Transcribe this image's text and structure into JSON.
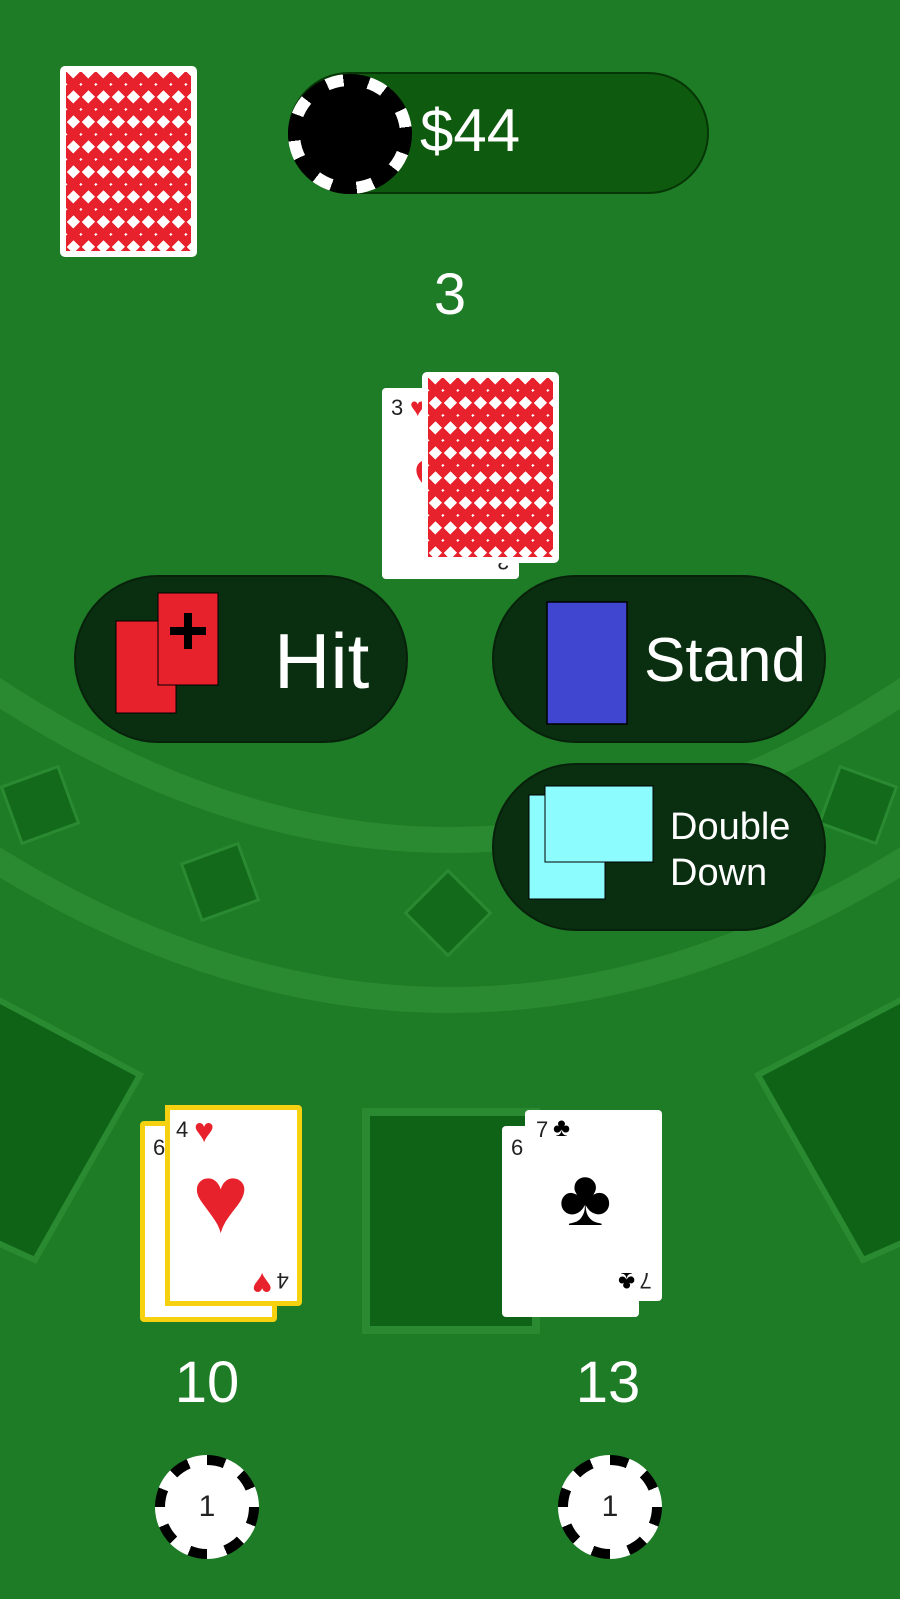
{
  "bank": {
    "amount": "$44"
  },
  "dealer": {
    "count": "3",
    "card": {
      "rank": "3",
      "suit": "♥"
    }
  },
  "actions": {
    "hit": "Hit",
    "stand": "Stand",
    "double_line1": "Double",
    "double_line2": "Down"
  },
  "hands": [
    {
      "count": "10",
      "bet": "1",
      "cards": [
        {
          "rank": "6",
          "suit": "♥",
          "color": "#e8222c"
        },
        {
          "rank": "4",
          "suit": "♥",
          "color": "#e8222c"
        }
      ]
    },
    {
      "count": "13",
      "bet": "1",
      "cards": [
        {
          "rank": "6",
          "suit": "♣",
          "color": "#000000"
        },
        {
          "rank": "7",
          "suit": "♣",
          "color": "#000000"
        }
      ]
    }
  ],
  "colors": {
    "felt": "#1e7b26",
    "button_bg": "#0a2f10",
    "active_hand_outline": "#f5d10f",
    "card_back": "#e8222c",
    "stand_icon": "#4046cf",
    "double_icon": "#8cfcff"
  }
}
